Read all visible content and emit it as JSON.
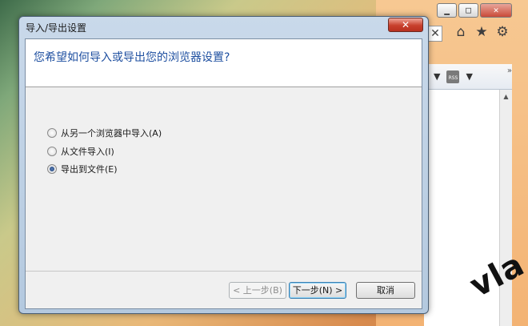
{
  "browser": {
    "window_buttons": [
      "▁",
      "□",
      "✕"
    ],
    "address_close": "✕",
    "toolbar_icons": [
      "home-icon",
      "star-icon",
      "gear-icon"
    ],
    "rss_label": "RSS",
    "chevron": "»"
  },
  "dialog": {
    "title": "导入/导出设置",
    "close": "✕",
    "question": "您希望如何导入或导出您的浏览器设置?",
    "options": [
      {
        "label": "从另一个浏览器中导入(A)",
        "checked": false
      },
      {
        "label": "从文件导入(I)",
        "checked": false
      },
      {
        "label": "导出到文件(E)",
        "checked": true
      }
    ],
    "buttons": {
      "back": "< 上一步(B)",
      "next": "下一步(N) >",
      "cancel": "取消"
    }
  },
  "watermark": "vla"
}
